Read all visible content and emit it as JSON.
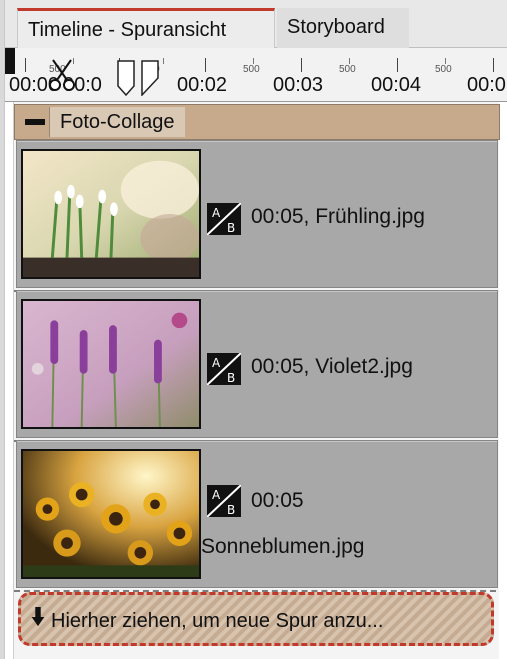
{
  "tabs": [
    {
      "label": "Timeline - Spuransicht",
      "active": true
    },
    {
      "label": "Storyboard",
      "active": false
    }
  ],
  "ruler": {
    "minor_label": "500",
    "times": [
      "00:00",
      "00:0",
      "00:02",
      "00:03",
      "00:04",
      "00:0"
    ]
  },
  "group": {
    "title": "Foto-Collage",
    "header_color": "#c7a98c"
  },
  "clips": [
    {
      "duration": "00:05",
      "filename": "Frühling.jpg",
      "text": "00:05, Frühling.jpg",
      "image": "snowdrop-flowers"
    },
    {
      "duration": "00:05",
      "filename": "Violet2.jpg",
      "text": "00:05, Violet2.jpg",
      "image": "lavender-flowers"
    },
    {
      "duration": "00:05",
      "filename": "Sonneblumen.jpg",
      "image": "sunflower-field"
    }
  ],
  "transition_icon": {
    "top": "A",
    "bottom": "B"
  },
  "dropzone": {
    "label": "Hierher ziehen, um neue Spur anzu..."
  },
  "colors": {
    "accent_red": "#c0392b",
    "clip_gray": "#a8a8a8"
  }
}
